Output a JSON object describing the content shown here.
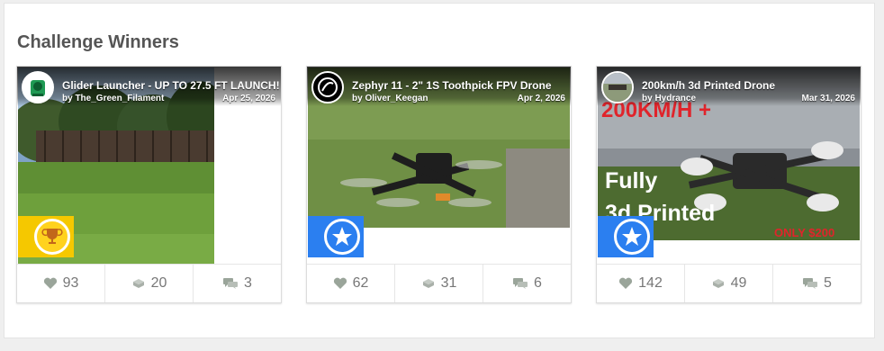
{
  "section": {
    "title": "Challenge Winners"
  },
  "cards": [
    {
      "title": "Glider Launcher - UP TO 27.5 FT LAUNCH!!",
      "author": "by The_Green_Filament",
      "date": "Apr 25, 2026",
      "badge": "trophy",
      "stats": {
        "likes": "93",
        "remixes": "20",
        "comments": "3"
      }
    },
    {
      "title": "Zephyr 11 - 2\" 1S Toothpick FPV Drone",
      "author": "by Oliver_Keegan",
      "date": "Apr 2, 2026",
      "badge": "star",
      "stats": {
        "likes": "62",
        "remixes": "31",
        "comments": "6"
      }
    },
    {
      "title": "200km/h 3d Printed Drone",
      "author": "by Hydrance",
      "date": "Mar 31, 2026",
      "badge": "star",
      "overlay": {
        "top": "200KM/H +",
        "line1": "Fully",
        "line2": "3d Printed",
        "price": "ONLY $200"
      },
      "stats": {
        "likes": "142",
        "remixes": "49",
        "comments": "5"
      }
    }
  ],
  "colors": {
    "heart": "#9aa59a",
    "trophy_badge": "#f5c800",
    "star_badge": "#2b7ff0"
  },
  "icons": {
    "likes": "heart-icon",
    "remixes": "layers-icon",
    "comments": "comments-icon",
    "trophy": "trophy-icon",
    "star": "star-icon"
  }
}
